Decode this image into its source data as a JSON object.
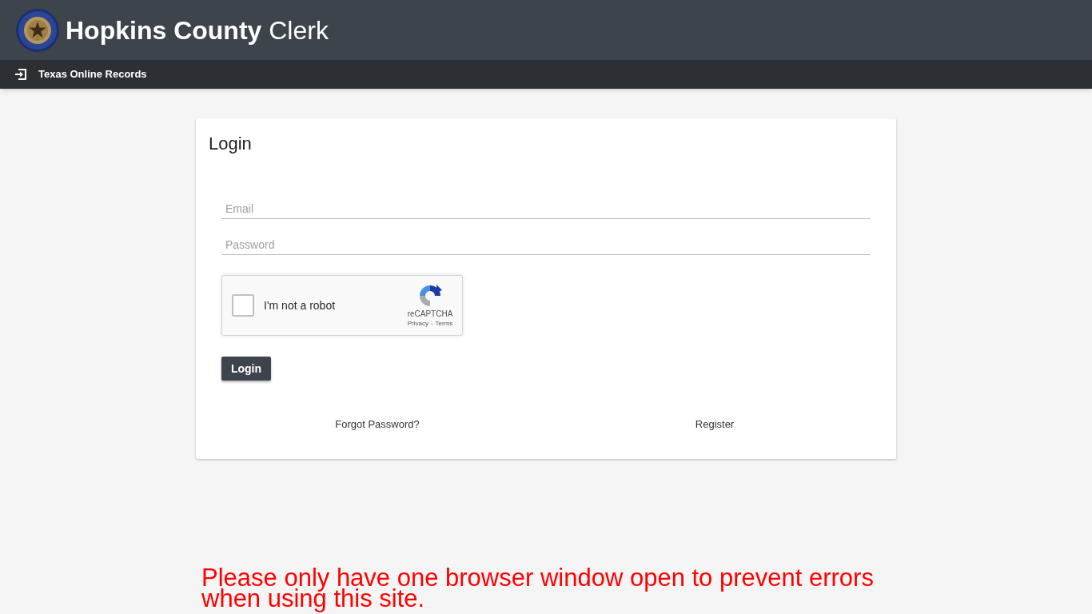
{
  "header": {
    "title": "**Hopkins County** Clerk"
  },
  "nav": {
    "items": [
      {
        "label": "Texas Online Records"
      }
    ]
  },
  "login_card": {
    "title": "Login",
    "fields": [
      {
        "placeholder": "Email"
      },
      {
        "placeholder": "Password"
      }
    ],
    "captcha": {
      "label": "I'm not a robot",
      "checked": false,
      "brand": "reCAPTCHA",
      "links": [
        "Privacy",
        "Terms"
      ],
      "separator": "-"
    },
    "submit": "Login",
    "links": [
      "Forgot Password?",
      "Register"
    ]
  },
  "notice": "Please only have one browser window open to prevent errors when using this site."
}
